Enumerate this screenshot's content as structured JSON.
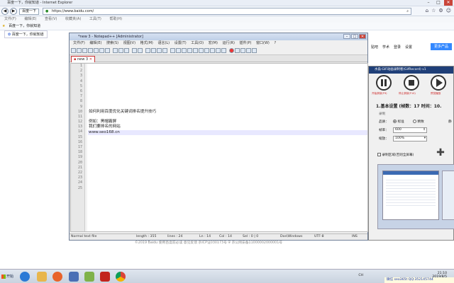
{
  "ie": {
    "title": "百度一下，你就知道 - Internet Explorer",
    "back_label": "◀",
    "forward_label": "▶",
    "mini_tab": "百度一下",
    "url": "https://www.baidu.com/",
    "menu": [
      "文件(F)",
      "编辑(E)",
      "查看(V)",
      "收藏夹(A)",
      "工具(T)",
      "帮助(H)"
    ],
    "fav_label": "百度一下，你就知道",
    "tab_label": "百度一下，你就知道"
  },
  "notepad": {
    "title": "*new 3 - Notepad++ [Administrator]",
    "menu": [
      "文件(F)",
      "编辑(E)",
      "搜索(S)",
      "视图(V)",
      "格式(M)",
      "语言(L)",
      "设置(T)",
      "工具(O)",
      "宏(M)",
      "运行(R)",
      "插件(P)",
      "窗口(W)",
      "?"
    ],
    "tab_label": "new 3",
    "line_numbers": [
      "1",
      "2",
      "3",
      "4",
      "5",
      "6",
      "7",
      "8",
      "9",
      "10",
      "11",
      "12",
      "13",
      "14",
      "15",
      "16",
      "17",
      "18",
      "19",
      "20",
      "21",
      "22",
      "23",
      "24",
      "25"
    ],
    "lines": {
      "l10": "如何利用百度优化关键词排名提升技巧",
      "l12": "例如：黑帽霸屏",
      "l13": "我们要排名的网站",
      "l14": "www.seo168.cn"
    },
    "status": {
      "type": "Normal text file",
      "length": "length : 355",
      "lines": "lines : 24",
      "ln": "Ln : 14",
      "col": "Col : 14",
      "sel": "Sel : 0 | 0",
      "eol": "Dos\\Windows",
      "enc": "UTF-8",
      "mode": "INS"
    }
  },
  "baidu_right": {
    "links": [
      "贴吧",
      "学术",
      "登录",
      "设置"
    ],
    "more_button": "更多产品"
  },
  "recorder": {
    "title": "水淼·GIF动画录制者(GifRecord) v1",
    "buttons": [
      "开始录制(F9)",
      "停止录制(F10)",
      "预览播放"
    ],
    "section": "1.基本设置 (帧数：17 时间：10.",
    "record_label": "录制",
    "quality_label": "品质：",
    "opt_normal": "标准",
    "opt_fine": "精致",
    "fps_label": "帧率：",
    "fps_value": "600",
    "scale_label": "缩放：",
    "scale_value": "100%",
    "region_label": "录制区域(否则全屏幕)",
    "side_label": "静"
  },
  "footer": "©2019 Baidu 使用百度前必读 意见反馈 京ICP证030173号",
  "footer2": "京公网安备11000002000001号",
  "taskbar": {
    "start_label": "开始",
    "tray_label": "CH",
    "time": "21:10",
    "date": "2019/8/5",
    "wechat": "微信 seo365t QQ:352145744"
  },
  "colors": {
    "accent": "#3388ff",
    "recorder_title": "#1f3f78"
  }
}
